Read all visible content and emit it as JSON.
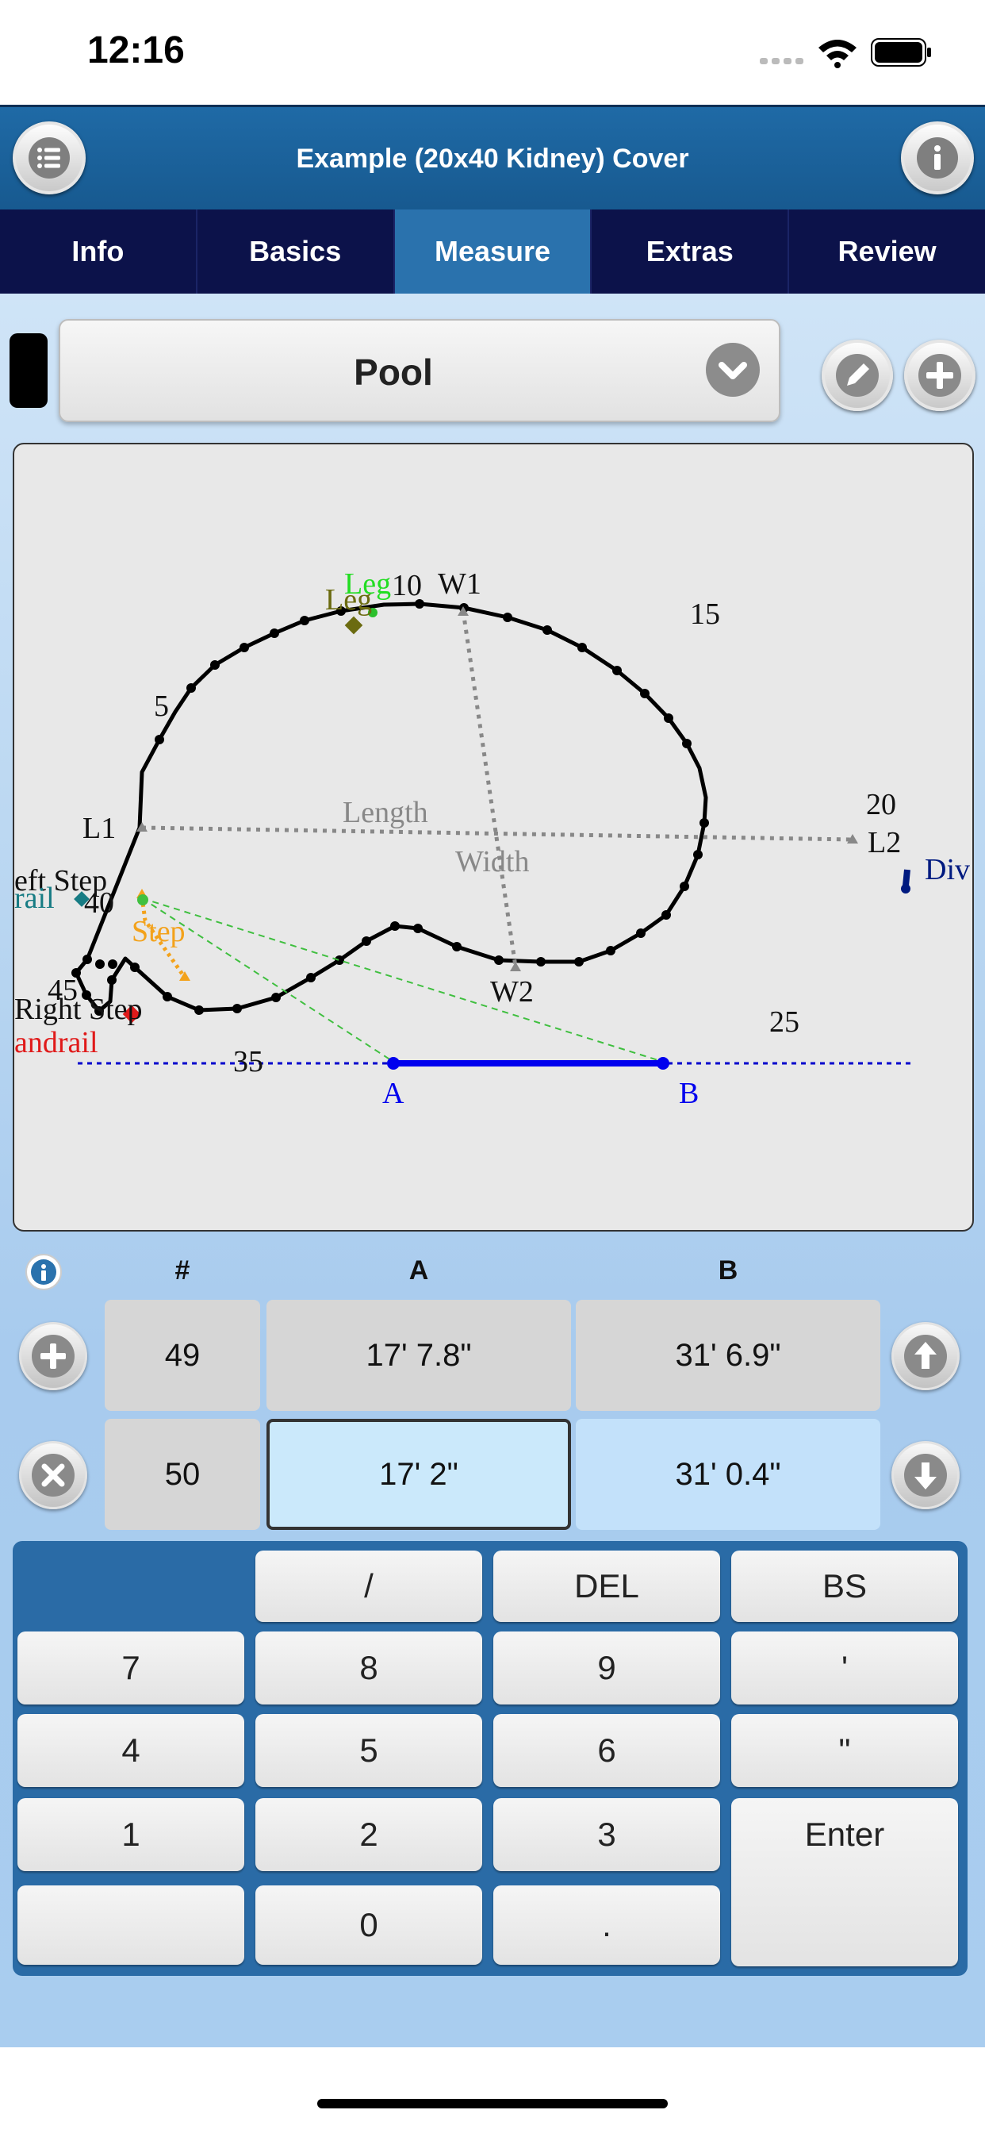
{
  "status": {
    "time": "12:16"
  },
  "header": {
    "title": "Example (20x40 Kidney) Cover"
  },
  "tabs": [
    "Info",
    "Basics",
    "Measure",
    "Extras",
    "Review"
  ],
  "active_tab": "Measure",
  "selector": {
    "value": "Pool"
  },
  "drawing": {
    "labels": {
      "w1": "W1",
      "w2": "W2",
      "l1": "L1",
      "l2": "L2",
      "length": "Length",
      "width": "Width",
      "leg1": "Leg",
      "leg2": "Leg",
      "left_step": "eft Step",
      "rail": "rail",
      "step": "Step",
      "right_step": "Right Step",
      "handrail": "andrail",
      "div": "Div",
      "a": "A",
      "b": "B",
      "n5": "5",
      "n10": "10",
      "n15": "15",
      "n20": "20",
      "n25": "25",
      "n35": "35",
      "n45": "45",
      "n40": "40"
    }
  },
  "table": {
    "headers": {
      "num": "#",
      "a": "A",
      "b": "B"
    },
    "rows": [
      {
        "num": "49",
        "a": "17' 7.8\"",
        "b": "31' 6.9\""
      },
      {
        "num": "50",
        "a": "17' 2\"",
        "b": "31' 0.4\""
      }
    ]
  },
  "keypad": {
    "slash": "/",
    "del": "DEL",
    "bs": "BS",
    "k7": "7",
    "k8": "8",
    "k9": "9",
    "foot": "'",
    "k4": "4",
    "k5": "5",
    "k6": "6",
    "inch": "\"",
    "k1": "1",
    "k2": "2",
    "k3": "3",
    "enter": "Enter",
    "k0": "0",
    "dot": "."
  }
}
